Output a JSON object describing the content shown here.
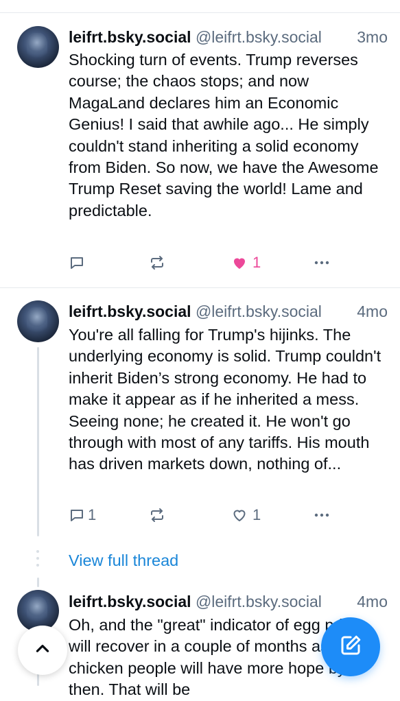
{
  "posts": [
    {
      "author": "leifrt.bsky.social",
      "handle": "@leifrt.bsky.social",
      "age": "3mo",
      "text": "Shocking turn of events.  Trump reverses course; the chaos stops; and now MagaLand declares him an Economic Genius!  I said that awhile ago...   He simply couldn't stand inheriting a solid economy from Biden. So now, we have the Awesome Trump Reset saving the world! Lame and predictable.",
      "replies": "",
      "likes": "1",
      "liked": true
    },
    {
      "author": "leifrt.bsky.social",
      "handle": "@leifrt.bsky.social",
      "age": "4mo",
      "text": "You're all falling for Trump's hijinks. The underlying economy is solid. Trump couldn't inherit Biden’s strong economy.  He had to make it appear as if he inherited a mess. Seeing none; he created it. He won't go through with most of any tariffs.  His mouth has driven markets down, nothing of...",
      "replies": "1",
      "likes": "1",
      "liked": false
    },
    {
      "author": "leifrt.bsky.social",
      "handle": "@leifrt.bsky.social",
      "age": "4mo",
      "text": "Oh, and the \"great\" indicator of egg prices will recover in a couple of months as the chicken people will have more hope by then.  That will be"
    }
  ],
  "thread": {
    "view_full_thread": "View full thread"
  },
  "icons": {
    "reply": "reply-icon",
    "repost": "repost-icon",
    "like": "heart-icon",
    "more": "more-icon",
    "scroll_top": "chevron-up-icon",
    "compose": "compose-icon"
  },
  "colors": {
    "accent": "#1d8cf8",
    "like": "#ec4899",
    "link": "#1a86d8",
    "muted": "#5b6b7e"
  }
}
